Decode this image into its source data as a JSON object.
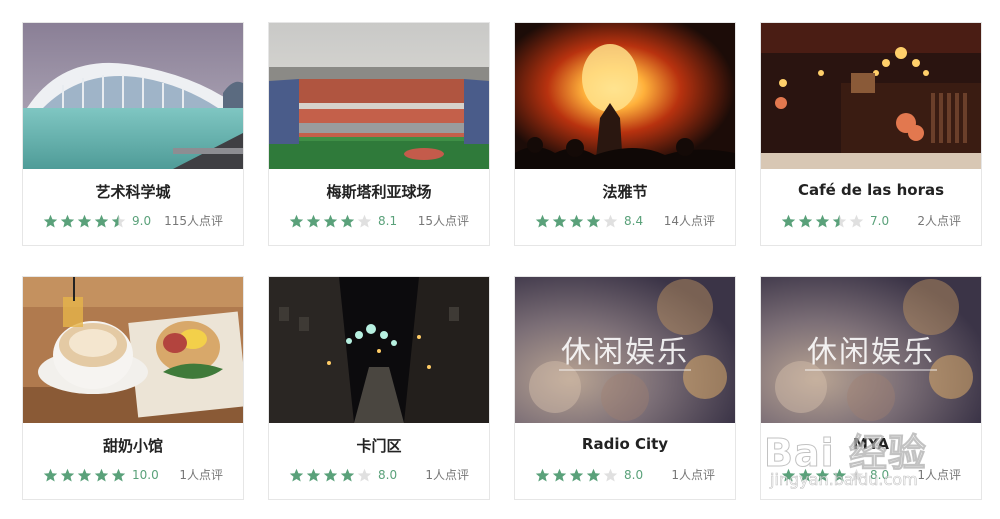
{
  "cards": [
    {
      "title": "艺术科学城",
      "rating": 4.5,
      "score": "9.0",
      "reviews": "115人点评",
      "image": "city-of-arts-photo"
    },
    {
      "title": "梅斯塔利亚球场",
      "rating": 4,
      "score": "8.1",
      "reviews": "15人点评",
      "image": "stadium-photo"
    },
    {
      "title": "法雅节",
      "rating": 4,
      "score": "8.4",
      "reviews": "14人点评",
      "image": "fireworks-photo"
    },
    {
      "title": "Café de las horas",
      "rating": 3.5,
      "score": "7.0",
      "reviews": "2人点评",
      "image": "cafe-interior-photo"
    },
    {
      "title": "甜奶小馆",
      "rating": 5,
      "score": "10.0",
      "reviews": "1人点评",
      "image": "coffee-food-photo"
    },
    {
      "title": "卡门区",
      "rating": 4,
      "score": "8.0",
      "reviews": "1人点评",
      "image": "night-street-photo"
    },
    {
      "title": "Radio City",
      "rating": 4,
      "score": "8.0",
      "reviews": "1人点评",
      "image": "placeholder-leisure",
      "placeholder_text": "休闲娱乐"
    },
    {
      "title": "MYA",
      "rating": 4,
      "score": "8.0",
      "reviews": "1人点评",
      "image": "placeholder-leisure",
      "placeholder_text": "休闲娱乐"
    }
  ],
  "colors": {
    "star_filled": "#5aa17a",
    "star_empty": "#e0e0e0",
    "score": "#5aa17a",
    "title": "#222222",
    "meta": "#777777",
    "border": "#e6e6e6"
  },
  "watermark": {
    "main": "Bai 经验",
    "sub": "jingyan.baidu.com"
  }
}
